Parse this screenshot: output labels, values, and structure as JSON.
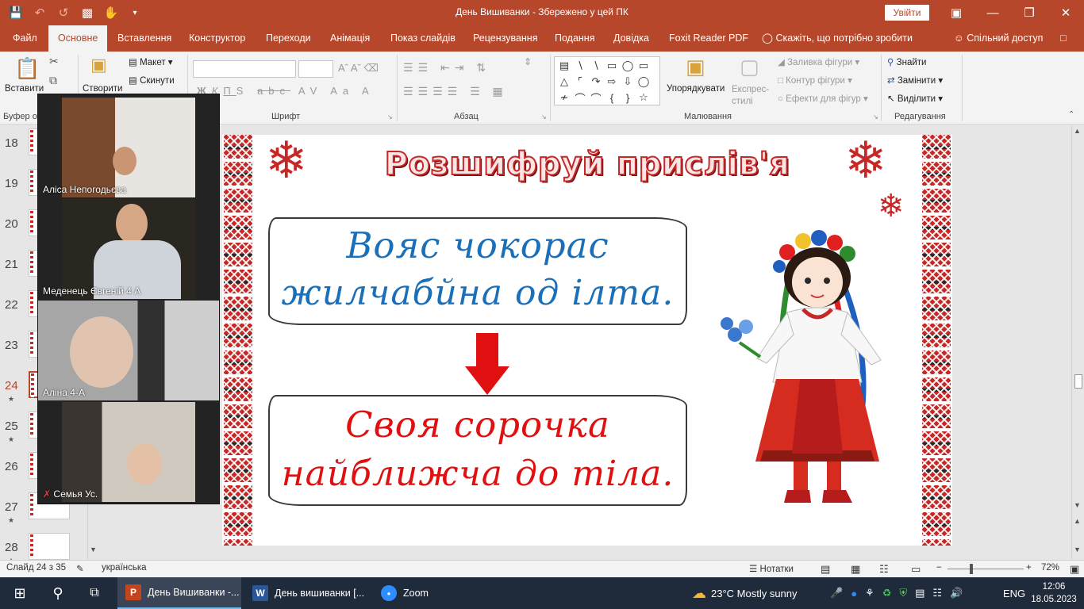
{
  "window": {
    "title": "День Вишиванки  -  Збережено у цей ПК",
    "signin_label": "Увійти"
  },
  "ribbon": {
    "tabs": [
      "Файл",
      "Основне",
      "Вставлення",
      "Конструктор",
      "Переходи",
      "Анімація",
      "Показ слайдів",
      "Рецензування",
      "Подання",
      "Довідка",
      "Foxit Reader PDF"
    ],
    "tell_me": "Скажіть, що потрібно зробити",
    "share": "Спільний доступ",
    "clipboard": {
      "paste": "Вставити",
      "group": "Буфер о"
    },
    "slides": {
      "new_slide": "Створити",
      "layout": "Макет",
      "reset": "Скинути"
    },
    "font": {
      "group": "Шрифт"
    },
    "paragraph": {
      "group": "Абзац"
    },
    "drawing": {
      "arrange": "Упорядкувати",
      "quick_styles": "Експрес-стилі",
      "shape_fill": "Заливка фігури",
      "shape_outline": "Контур фігури",
      "shape_effects": "Ефекти для фігур",
      "group": "Малювання"
    },
    "editing": {
      "find": "Знайти",
      "replace": "Замінити",
      "select": "Виділити",
      "group": "Редагування"
    }
  },
  "thumbnails": [
    {
      "num": "18",
      "star": false
    },
    {
      "num": "19",
      "star": false
    },
    {
      "num": "20",
      "star": false
    },
    {
      "num": "21",
      "star": false
    },
    {
      "num": "22",
      "star": false
    },
    {
      "num": "23",
      "star": false
    },
    {
      "num": "24",
      "star": true,
      "current": true
    },
    {
      "num": "25",
      "star": true
    },
    {
      "num": "26",
      "star": false
    },
    {
      "num": "27",
      "star": true
    },
    {
      "num": "28",
      "star": true
    }
  ],
  "slide": {
    "title": "Розшифруй прислів'я",
    "encoded_line1": "Вояс чокорас",
    "encoded_line2": "жилчабйна од ілта.",
    "decoded_line1": "Своя сорочка",
    "decoded_line2": "найближча до тіла.",
    "colors": {
      "encoded": "#1a6fb8",
      "decoded": "#e01010",
      "ornament": "#c62828"
    }
  },
  "zoom_participants": [
    {
      "name": "Аліса Непогодьєва",
      "muted": false
    },
    {
      "name": "Меденець Євгеній 4 А",
      "muted": false
    },
    {
      "name": "Аліна 4-А",
      "muted": false
    },
    {
      "name": "Семья Ус.",
      "muted": true
    }
  ],
  "status": {
    "slide_info": "Слайд 24 з 35",
    "language": "українська",
    "notes": "Нотатки",
    "zoom": "72%"
  },
  "taskbar": {
    "apps": [
      {
        "label": "День Вишиванки -...",
        "icon": "powerpoint-icon",
        "active": true
      },
      {
        "label": "День вишиванки [...",
        "icon": "word-icon",
        "active": false
      },
      {
        "label": "Zoom",
        "icon": "zoom-icon",
        "active": false
      }
    ],
    "weather": "23°C  Mostly sunny",
    "lang": "ENG",
    "time": "12:06",
    "date": "18.05.2023"
  }
}
